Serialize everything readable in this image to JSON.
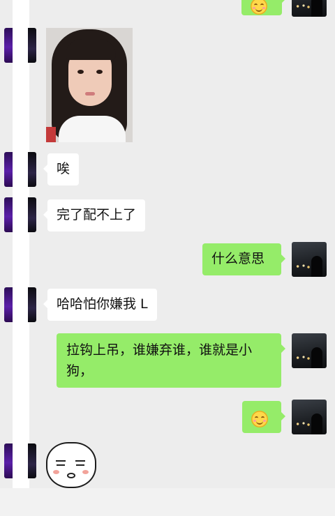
{
  "messages": {
    "photo_sticker": "photo",
    "m1": "唉",
    "m2": "完了配不上了",
    "m3": "什么意思",
    "m4": "哈哈怕你嫌我 L",
    "m5": "拉钩上吊，谁嫌弃谁，谁就是小狗，",
    "m6_emoji": "smiley",
    "m7_sticker": "sticker"
  },
  "colors": {
    "background": "#ededed",
    "bubble_left": "#ffffff",
    "bubble_right": "#95ec69"
  },
  "icons": {
    "avatar_left": "avatar",
    "avatar_right": "avatar",
    "emoji": "smiley-icon"
  }
}
